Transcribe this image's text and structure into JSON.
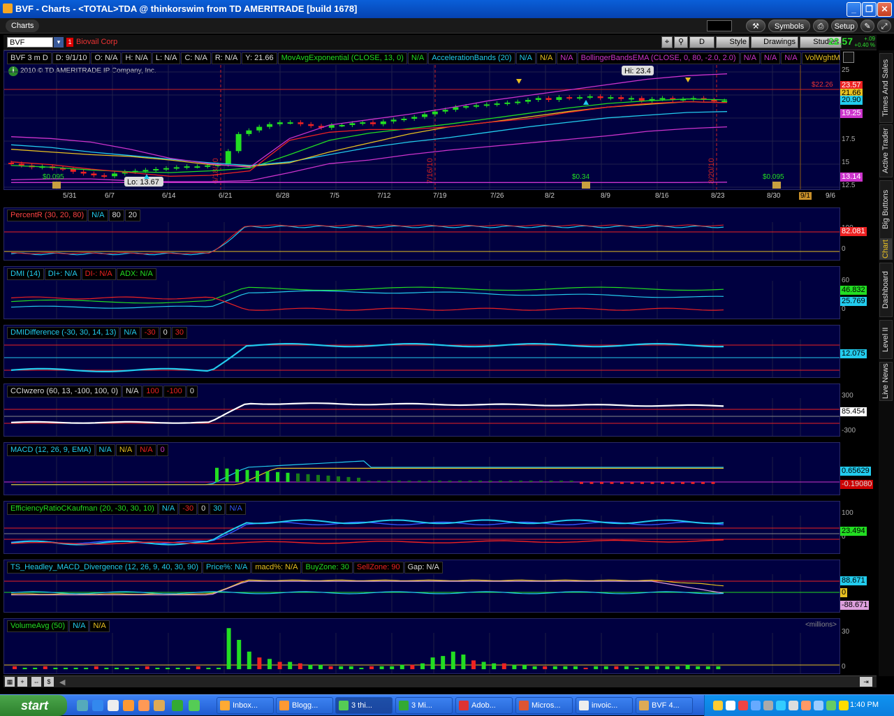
{
  "window": {
    "title": "BVF - Charts - <TOTAL>TDA @ thinkorswim from TD AMERITRADE [build 1678]",
    "minimize_icon": "minimize-icon",
    "maximize_icon": "maximize-icon",
    "close_icon": "close-icon"
  },
  "menubar": {
    "charts_tab": "Charts",
    "symbols_button": "Symbols",
    "setup_button": "Setup"
  },
  "toolbar": {
    "symbol": "BVF",
    "company": "Biovail Corp",
    "period_button": "D",
    "style_button": "Style",
    "drawings_button": "Drawings",
    "studies_button": "Studies",
    "last_price": "22.57",
    "net_change": "+.09",
    "pct_change": "+0.40 %"
  },
  "price_panel": {
    "header": [
      "BVF 3 m D",
      "D: 9/1/10",
      "O: N/A",
      "H: N/A",
      "L: N/A",
      "C: N/A",
      "R: N/A",
      "Y: 21.66",
      "MovAvgExponential (CLOSE, 13, 0)",
      "N/A",
      "AccelerationBands (20)",
      "N/A",
      "N/A",
      "N/A",
      "BollingerBandsEMA (CLOSE, 0, 80, -2.0, 2.0)",
      "N/A",
      "N/A",
      "N/A",
      "VolWghtMACDXover (..."
    ],
    "copyright": "2010 © TD AMERITRADE IP Company, Inc.",
    "hi_label": "Hi: 23.4",
    "lo_label": "Lo: 13.67",
    "price_line_label": "$22.26",
    "vertical_markers": [
      "6/18/10",
      "7/16/10",
      "8/20/10"
    ],
    "dividends": [
      "$0.095",
      "$0.34",
      "$0.095"
    ],
    "x_labels": [
      "5/31",
      "6/7",
      "6/14",
      "6/21",
      "6/28",
      "7/5",
      "7/12",
      "7/19",
      "7/26",
      "8/2",
      "8/9",
      "8/16",
      "8/23",
      "8/30",
      "9/1",
      "9/6"
    ],
    "y_labels": [
      "25",
      "22.5",
      "20",
      "17.5",
      "15",
      "12.5"
    ],
    "tags": [
      "23.57",
      "21.66",
      "20.90",
      "19.25",
      "13.14"
    ]
  },
  "panels": [
    {
      "name": "PercentR (30, 20, 80)",
      "fields": [
        "N/A",
        "80",
        "20"
      ],
      "value": "82.081",
      "ylabels": [
        "100",
        "0"
      ]
    },
    {
      "name": "DMI (14)",
      "fields": [
        "DI+: N/A",
        "DI-: N/A",
        "ADX: N/A"
      ],
      "value": "46.832",
      "value2": "25.769",
      "ylabels": [
        "60",
        "0"
      ]
    },
    {
      "name": "DMIDifference (-30, 30, 14, 13)",
      "fields": [
        "N/A",
        "-30",
        "0",
        "30"
      ],
      "value": "12.075",
      "ylabels": []
    },
    {
      "name": "CCIwzero (60, 13, -100, 100, 0)",
      "fields": [
        "N/A",
        "100",
        "-100",
        "0"
      ],
      "value": "85.454",
      "ylabels": [
        "300",
        "-300"
      ]
    },
    {
      "name": "MACD (12, 26, 9, EMA)",
      "fields": [
        "N/A",
        "N/A",
        "N/A",
        "0"
      ],
      "value": "0.65629",
      "value2": "-0.19080",
      "ylabels": []
    },
    {
      "name": "EfficiencyRatioCKaufman (20, -30, 30, 10)",
      "fields": [
        "N/A",
        "-30",
        "0",
        "30",
        "N/A"
      ],
      "value": "23.494",
      "ylabels": [
        "100",
        "0"
      ]
    },
    {
      "name": "TS_Headley_MACD_Divergence (12, 26, 9, 40, 30, 90)",
      "fields": [
        "Price%: N/A",
        "macd%: N/A",
        "BuyZone: 30",
        "SellZone: 90",
        "Gap: N/A"
      ],
      "value": "88.671",
      "value2": "0",
      "value3": "-88.671",
      "ylabels": []
    },
    {
      "name": "VolumeAvg (50)",
      "fields": [
        "N/A",
        "N/A"
      ],
      "value": "<millions>",
      "ylabels": [
        "30",
        "0"
      ]
    }
  ],
  "sidebar": [
    "Times And Sales",
    "Active Trader",
    "Big Buttons",
    "Chart",
    "Dashboard",
    "Level II",
    "Live News"
  ],
  "taskbar": {
    "start": "start",
    "tasks": [
      "Inbox...",
      "Blogg...",
      "3 thi...",
      "3 Mi...",
      "Adob...",
      "Micros...",
      "invoic...",
      "BVF 4..."
    ],
    "clock": "1:40 PM"
  },
  "colors": {
    "panel_bg": "#000040",
    "up": "#22dd22",
    "down": "#ee2222",
    "cyan": "#22ccee",
    "magenta": "#cc33cc",
    "yellow": "#e8c020"
  }
}
